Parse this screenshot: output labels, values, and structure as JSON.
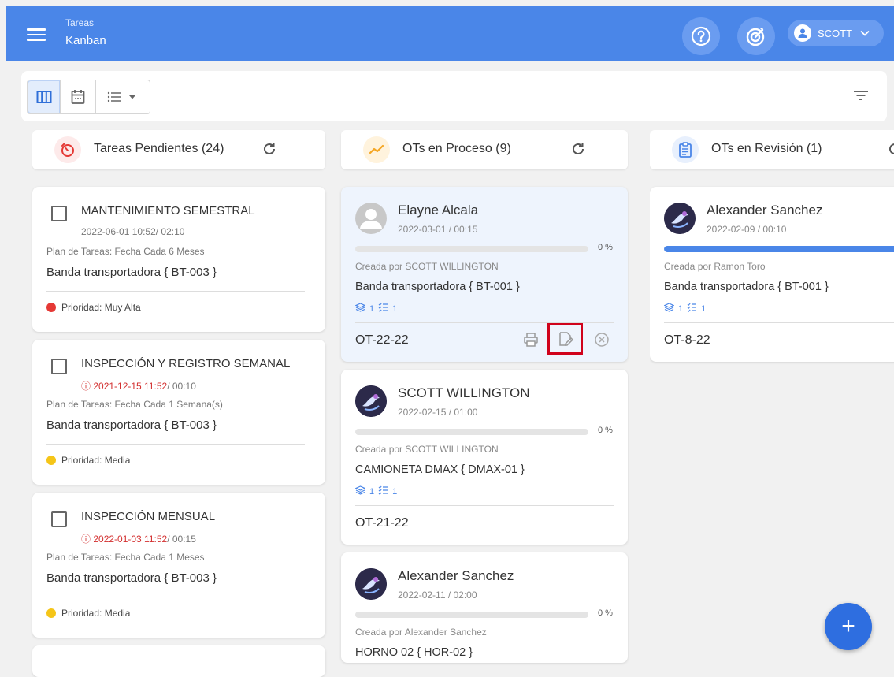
{
  "header": {
    "app_title": "Tareas",
    "section_title": "Kanban",
    "user_name": "SCOTT",
    "icons": [
      "menu-icon",
      "help-icon",
      "target-icon",
      "user-icon",
      "chevron-down-icon"
    ]
  },
  "toolbar": {
    "views": [
      "board-view-icon",
      "calendar-icon",
      "list-view-icon"
    ],
    "active_view": "board",
    "filter_icon": "filter-icon"
  },
  "columns": [
    {
      "title": "Tareas Pendientes (24)",
      "icon": "timer-icon",
      "icon_color": "#e53935"
    },
    {
      "title": "OTs en Proceso (9)",
      "icon": "trending-icon",
      "icon_color": "#f5a623"
    },
    {
      "title": "OTs en Revisión (1)",
      "icon": "clipboard-icon",
      "icon_color": "#4a86e8"
    }
  ],
  "tasks": [
    {
      "title": "MANTENIMIENTO SEMESTRAL",
      "date": "2022-06-01 10:52",
      "duration": "/ 02:10",
      "plan": "Plan de Tareas: Fecha Cada 6 Meses",
      "asset": "Banda transportadora { BT-003 }",
      "priority": "Prioridad: Muy Alta",
      "priority_color": "#e53935"
    },
    {
      "title": "INSPECCIÓN Y REGISTRO SEMANAL",
      "date": "2021-12-15 11:52",
      "duration": "/ 00:10",
      "plan": "Plan de Tareas: Fecha Cada 1 Semana(s)",
      "asset": "Banda transportadora { BT-003 }",
      "priority": "Prioridad: Media",
      "priority_color": "#f5c518"
    },
    {
      "title": "INSPECCIÓN MENSUAL",
      "date": "2022-01-03 11:52",
      "duration": "/ 00:15",
      "plan": "Plan de Tareas: Fecha Cada 1 Meses",
      "asset": "Banda transportadora { BT-003 }",
      "priority": "Prioridad: Media",
      "priority_color": "#f5c518"
    }
  ],
  "in_process": [
    {
      "name": "Elayne Alcala",
      "date": "2022-03-01 / 00:15",
      "progress": "0 %",
      "progress_value": 0,
      "creator": "Creada por SCOTT WILLINGTON",
      "asset": "Banda transportadora { BT-001 }",
      "counts": [
        "1",
        "1"
      ],
      "code": "OT-22-22"
    },
    {
      "name": "SCOTT WILLINGTON",
      "date": "2022-02-15 / 01:00",
      "progress": "0 %",
      "progress_value": 0,
      "creator": "Creada por SCOTT WILLINGTON",
      "asset": "CAMIONETA DMAX { DMAX-01 }",
      "counts": [
        "1",
        "1"
      ],
      "code": "OT-21-22"
    },
    {
      "name": "Alexander Sanchez",
      "date": "2022-02-11 / 02:00",
      "progress": "0 %",
      "progress_value": 0,
      "creator": "Creada por Alexander Sanchez",
      "asset": "HORNO 02 { HOR-02 }"
    }
  ],
  "in_review": [
    {
      "name": "Alexander Sanchez",
      "date": "2022-02-09 / 00:10",
      "progress_value": 100,
      "creator": "Creada por Ramon Toro",
      "asset": "Banda transportadora { BT-001 }",
      "counts": [
        "1",
        "1"
      ],
      "code": "OT-8-22"
    }
  ],
  "fab_label": "+"
}
